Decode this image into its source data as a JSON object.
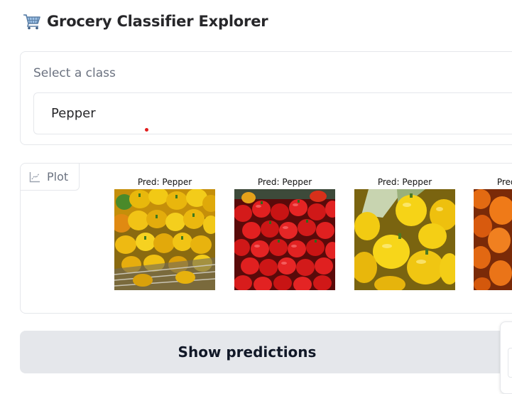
{
  "app": {
    "title": "Grocery Classifier Explorer",
    "title_icon": "shopping-cart-icon"
  },
  "class_selector": {
    "label": "Select a class",
    "value": "Pepper"
  },
  "plot": {
    "tab_label": "Plot",
    "tab_icon": "line-chart-icon",
    "predictions": [
      {
        "label": "Pred: Pepper",
        "image": "yellow bell peppers in crate"
      },
      {
        "label": "Pred: Pepper",
        "image": "red bell peppers pile"
      },
      {
        "label": "Pred: Pepper",
        "image": "yellow bell peppers close-up"
      },
      {
        "label": "Pred: Pepper",
        "image": "orange bell peppers"
      }
    ]
  },
  "actions": {
    "show_predictions_label": "Show predictions"
  },
  "colors": {
    "panel_border": "#e5e7eb",
    "button_bg": "#e5e7eb",
    "label_gray": "#6b7280",
    "cursor_dot": "#e11d1d"
  }
}
